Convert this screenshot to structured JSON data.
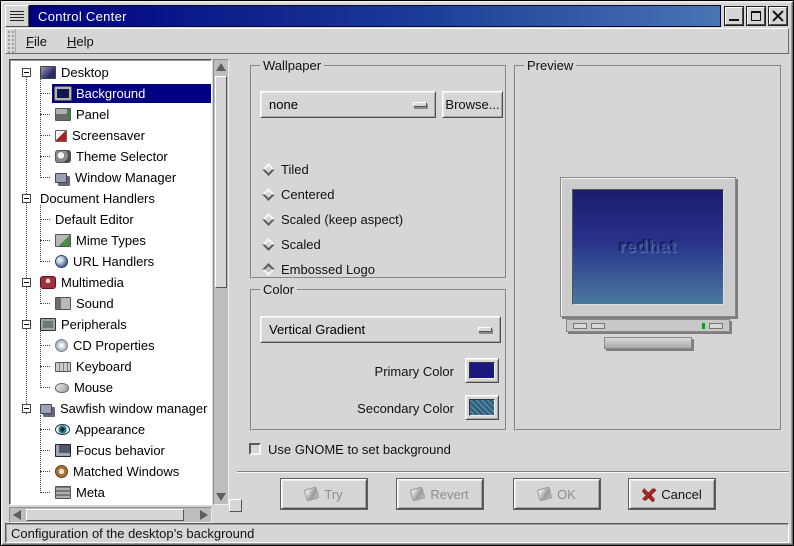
{
  "window": {
    "title": "Control Center",
    "buttons": [
      {
        "name": "minimize"
      },
      {
        "name": "maximize"
      },
      {
        "name": "close"
      }
    ]
  },
  "menubar": {
    "items": [
      {
        "label": "File"
      },
      {
        "label": "Help"
      }
    ]
  },
  "tree": {
    "items": [
      {
        "label": "Desktop",
        "depth": 0,
        "expander": true,
        "icon": "desktop-icon",
        "selected": false
      },
      {
        "label": "Background",
        "depth": 1,
        "icon": "monitor-icon",
        "selected": true
      },
      {
        "label": "Panel",
        "depth": 1,
        "icon": "panel-icon",
        "selected": false
      },
      {
        "label": "Screensaver",
        "depth": 1,
        "icon": "screensaver-icon",
        "selected": false
      },
      {
        "label": "Theme Selector",
        "depth": 1,
        "icon": "theme-icon",
        "selected": false
      },
      {
        "label": "Window Manager",
        "depth": 1,
        "icon": "window-manager-icon",
        "selected": false
      },
      {
        "label": "Document Handlers",
        "depth": 0,
        "expander": true,
        "icon": null,
        "selected": false
      },
      {
        "label": "Default Editor",
        "depth": 1,
        "icon": null,
        "selected": false
      },
      {
        "label": "Mime Types",
        "depth": 1,
        "icon": "mime-icon",
        "selected": false
      },
      {
        "label": "URL Handlers",
        "depth": 1,
        "icon": "url-icon",
        "selected": false
      },
      {
        "label": "Multimedia",
        "depth": 0,
        "expander": true,
        "icon": "multimedia-icon",
        "selected": false
      },
      {
        "label": "Sound",
        "depth": 1,
        "icon": "sound-icon",
        "selected": false
      },
      {
        "label": "Peripherals",
        "depth": 0,
        "expander": true,
        "icon": "peripherals-icon",
        "selected": false
      },
      {
        "label": "CD Properties",
        "depth": 1,
        "icon": "cd-icon",
        "selected": false
      },
      {
        "label": "Keyboard",
        "depth": 1,
        "icon": "keyboard-icon",
        "selected": false
      },
      {
        "label": "Mouse",
        "depth": 1,
        "icon": "mouse-icon",
        "selected": false
      },
      {
        "label": "Sawfish window manager",
        "depth": 0,
        "expander": true,
        "icon": "sawfish-icon",
        "selected": false
      },
      {
        "label": "Appearance",
        "depth": 1,
        "icon": "appearance-icon",
        "selected": false
      },
      {
        "label": "Focus behavior",
        "depth": 1,
        "icon": "focus-icon",
        "selected": false
      },
      {
        "label": "Matched Windows",
        "depth": 1,
        "icon": "matched-icon",
        "selected": false
      },
      {
        "label": "Meta",
        "depth": 1,
        "icon": "meta-icon",
        "selected": false
      }
    ]
  },
  "wallpaper": {
    "legend": "Wallpaper",
    "dropdown_value": "none",
    "browse_label": "Browse...",
    "radios": [
      {
        "label": "Tiled",
        "selected": false
      },
      {
        "label": "Centered",
        "selected": false
      },
      {
        "label": "Scaled (keep aspect)",
        "selected": false
      },
      {
        "label": "Scaled",
        "selected": false
      },
      {
        "label": "Embossed Logo",
        "selected": true
      }
    ]
  },
  "color": {
    "legend": "Color",
    "dropdown_value": "Vertical Gradient",
    "primary_label": "Primary Color",
    "secondary_label": "Secondary Color",
    "primary_hex": "#191980",
    "secondary_hex": "#4a84a0"
  },
  "preview": {
    "legend": "Preview",
    "logo_text": "redhat"
  },
  "gnome_checkbox": {
    "label": "Use GNOME to set background",
    "checked": false
  },
  "action_buttons": [
    {
      "label": "Try",
      "icon": "try-icon",
      "disabled": true
    },
    {
      "label": "Revert",
      "icon": "revert-icon",
      "disabled": true
    },
    {
      "label": "OK",
      "icon": "ok-icon",
      "disabled": true
    },
    {
      "label": "Cancel",
      "icon": "cancel-icon",
      "disabled": false
    }
  ],
  "statusbar": {
    "text": "Configuration of the desktop’s background"
  },
  "colors": {
    "selection": "#000080",
    "titlebar_gradient_start": "#000080",
    "titlebar_gradient_end": "#4a74b4"
  }
}
